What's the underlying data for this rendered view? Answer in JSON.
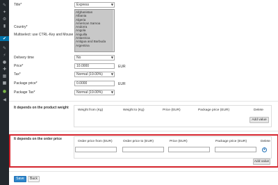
{
  "sidebar": {
    "icons": [
      "wrench-icon",
      "pin-icon",
      "gear-icon",
      "wrench-active-icon",
      "tag-icon",
      "brush-icon",
      "plugin-icon",
      "user-icon",
      "wrench-2-icon",
      "settings-icon",
      "box-icon",
      "leaf-icon",
      "collapse-icon"
    ]
  },
  "form": {
    "title_label": "Title*",
    "title_value": "Express",
    "country_label": "Country*",
    "multiselect_hint": "Multiselect: use CTRL-Key and Mouse",
    "countries": [
      "Afghanistan",
      "Albania",
      "Algeria",
      "American Samoa",
      "Andorra",
      "Angola",
      "Anguilla",
      "Antarctica",
      "Antigua and Barbuda",
      "Argentina"
    ],
    "delivery_time_label": "Delivery time",
    "delivery_time_value": "No",
    "price_label": "Price*",
    "price_value": "10.0000",
    "price_unit": "EUR",
    "tax_label": "Tax*",
    "tax_value": "Normal (19.00%)",
    "package_price_label": "Package price*",
    "package_price_value": "0.0000",
    "package_price_unit": "EUR",
    "package_tax_label": "Package Tax*",
    "package_tax_value": "Normal (19.00%)"
  },
  "weight_section": {
    "title": "It depends on the product weight",
    "headers": [
      "Weight from (Kg)",
      "Weight to (Kg)",
      "Price (EUR)",
      "Package price (EUR)",
      "Delete"
    ],
    "add_label": "Add value"
  },
  "order_price_section": {
    "title": "It depends on the order price",
    "headers": [
      "Order price from (EUR)",
      "Order price to (EUR)",
      "Price (EUR)",
      "Package price (EUR)",
      "Delete"
    ],
    "add_label": "Add value"
  },
  "actions": {
    "save_label": "Save",
    "back_label": "Back"
  }
}
